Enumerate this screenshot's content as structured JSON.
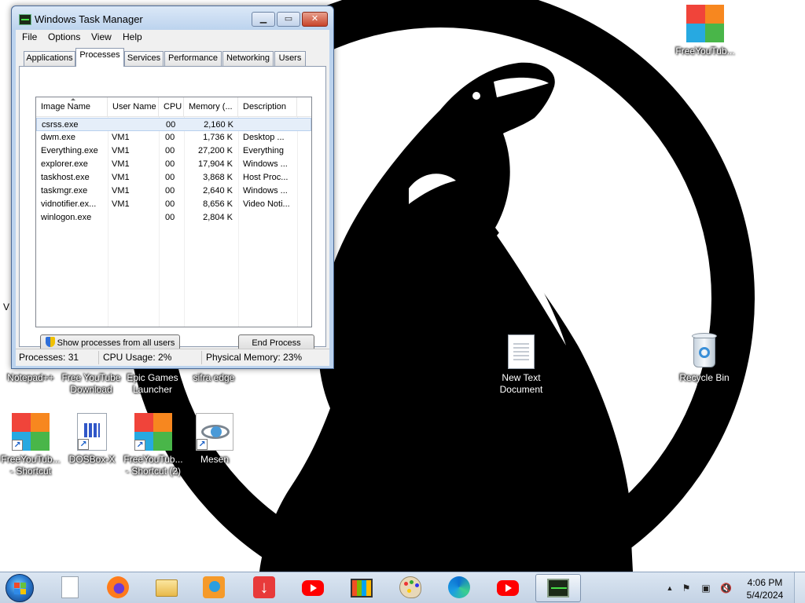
{
  "colors": {
    "wallpaper_black": "#000000",
    "wallpaper_white": "#ffffff",
    "window_frame": "#bcd3ee",
    "selection": "#e5eef9",
    "close_red": "#c8442a",
    "youtube_red": "#ff0000",
    "tile_red": "#f0443a",
    "tile_orange": "#f7871f",
    "tile_blue": "#27a9e1",
    "tile_green": "#49b649"
  },
  "desktop_icons": [
    {
      "label": "FreeYouTub...",
      "icon": "freeyoutube-tiles-icon"
    },
    {
      "label": "V",
      "icon": ""
    },
    {
      "label": "Notepad++",
      "icon": "notepadpp-icon"
    },
    {
      "label": "Free YouTube Download",
      "icon": "free-youtube-download-icon"
    },
    {
      "label": "Epic Games Launcher",
      "icon": "epic-games-icon"
    },
    {
      "label": "sifra edge",
      "icon": "edge-icon"
    },
    {
      "label": "New Text Document",
      "icon": "text-document-icon"
    },
    {
      "label": "Recycle Bin",
      "icon": "recycle-bin-icon"
    },
    {
      "label": "FreeYouTub... - Shortcut",
      "icon": "freeyoutube-tiles-icon"
    },
    {
      "label": "DOSBox-X",
      "icon": "dosbox-icon"
    },
    {
      "label": "FreeYouTub... - Shortcut (2)",
      "icon": "freeyoutube-tiles-icon"
    },
    {
      "label": "Mesen",
      "icon": "mesen-eye-icon"
    }
  ],
  "task_manager": {
    "title": "Windows Task Manager",
    "menu": [
      "File",
      "Options",
      "View",
      "Help"
    ],
    "tabs": [
      "Applications",
      "Processes",
      "Services",
      "Performance",
      "Networking",
      "Users"
    ],
    "active_tab": "Processes",
    "columns": [
      "Image Name",
      "User Name",
      "CPU",
      "Memory (...",
      "Description"
    ],
    "sorted_column": "Image Name",
    "processes": [
      {
        "name": "csrss.exe",
        "user": "",
        "cpu": "00",
        "memory": "2,160 K",
        "description": "",
        "selected": true
      },
      {
        "name": "dwm.exe",
        "user": "VM1",
        "cpu": "00",
        "memory": "1,736 K",
        "description": "Desktop ...",
        "selected": false
      },
      {
        "name": "Everything.exe",
        "user": "VM1",
        "cpu": "00",
        "memory": "27,200 K",
        "description": "Everything",
        "selected": false
      },
      {
        "name": "explorer.exe",
        "user": "VM1",
        "cpu": "00",
        "memory": "17,904 K",
        "description": "Windows ...",
        "selected": false
      },
      {
        "name": "taskhost.exe",
        "user": "VM1",
        "cpu": "00",
        "memory": "3,868 K",
        "description": "Host Proc...",
        "selected": false
      },
      {
        "name": "taskmgr.exe",
        "user": "VM1",
        "cpu": "00",
        "memory": "2,640 K",
        "description": "Windows ...",
        "selected": false
      },
      {
        "name": "vidnotifier.ex...",
        "user": "VM1",
        "cpu": "00",
        "memory": "8,656 K",
        "description": "Video Noti...",
        "selected": false
      },
      {
        "name": "winlogon.exe",
        "user": "",
        "cpu": "00",
        "memory": "2,804 K",
        "description": "",
        "selected": false
      }
    ],
    "show_all_label": "Show processes from all users",
    "end_process_label": "End Process",
    "status": {
      "processes": "Processes: 31",
      "cpu": "CPU Usage: 2%",
      "memory": "Physical Memory: 23%"
    }
  },
  "taskbar": {
    "items": [
      {
        "name": "start-button",
        "icon": "windows-orb-icon"
      },
      {
        "name": "taskbar-notepad",
        "icon": "blank-document-icon"
      },
      {
        "name": "taskbar-firefox",
        "icon": "firefox-icon"
      },
      {
        "name": "taskbar-explorer",
        "icon": "folder-icon"
      },
      {
        "name": "taskbar-media",
        "icon": "media-player-icon"
      },
      {
        "name": "taskbar-downloader",
        "icon": "download-arrow-icon"
      },
      {
        "name": "taskbar-youtube-1",
        "icon": "youtube-icon"
      },
      {
        "name": "taskbar-store",
        "icon": "store-bag-icon"
      },
      {
        "name": "taskbar-paint",
        "icon": "paint-palette-icon"
      },
      {
        "name": "taskbar-edge",
        "icon": "edge-icon"
      },
      {
        "name": "taskbar-youtube-2",
        "icon": "youtube-icon"
      },
      {
        "name": "taskbar-task-manager",
        "icon": "task-manager-icon",
        "active": true
      }
    ],
    "clock": {
      "time": "4:06 PM",
      "date": "5/4/2024"
    }
  }
}
